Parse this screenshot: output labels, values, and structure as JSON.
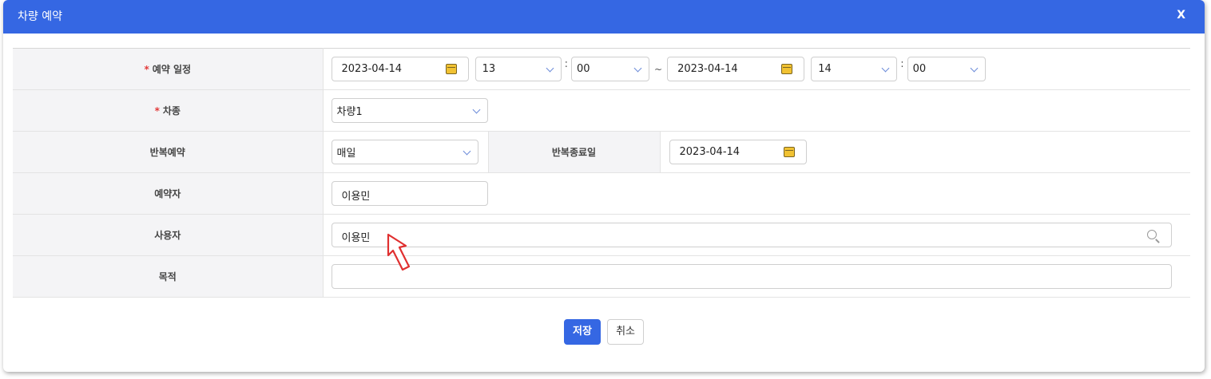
{
  "dialog": {
    "title": "차량 예약",
    "close_label": "X"
  },
  "form": {
    "schedule": {
      "label": "예약 일정",
      "start_date": "2023-04-14",
      "start_hour": "13",
      "start_minute": "00",
      "time_sep": ":",
      "range_sep": "~",
      "end_date": "2023-04-14",
      "end_hour": "14",
      "end_minute": "00"
    },
    "vehicle": {
      "label": "차종",
      "value": "차량1"
    },
    "repeat": {
      "label": "반복예약",
      "value": "매일",
      "end_label": "반복종료일",
      "end_date": "2023-04-14"
    },
    "reserver": {
      "label": "예약자",
      "value": "이용민"
    },
    "user": {
      "label": "사용자",
      "value": "이용민"
    },
    "purpose": {
      "label": "목적",
      "value": ""
    },
    "required_mark": "*"
  },
  "buttons": {
    "save": "저장",
    "cancel": "취소"
  },
  "colors": {
    "accent": "#3567e3",
    "required": "#e23a3a",
    "label_bg": "#f4f4f6"
  }
}
